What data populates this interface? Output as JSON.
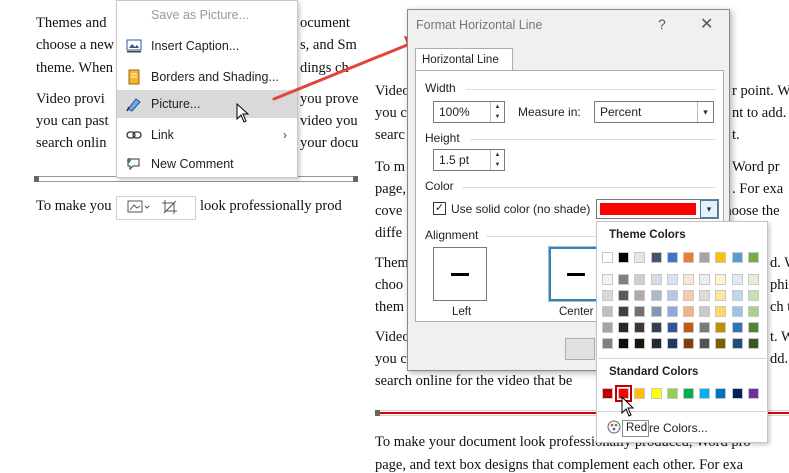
{
  "document": {
    "left_lines": [
      "Themes and",
      "choose a new",
      "theme. When",
      "Video provi",
      "you can past",
      "search onlin"
    ],
    "left_line_after_rule": "To make you",
    "left_fragments": [
      "ocument",
      "s, and Sm",
      "dings ch",
      "you prove",
      "video you",
      "your docu",
      "look professionally prod"
    ],
    "right_lines": [
      "Video",
      "you c",
      "searc",
      "To m",
      "page,",
      "cove",
      "diffe",
      "Them",
      "choo",
      "them",
      "Video",
      "you c",
      "search online for the video that be"
    ],
    "right_fragments": [
      "r point. W",
      "nt to add. Y",
      "t.",
      "Word pr",
      ". For exa",
      "choose the",
      "d. W",
      "phic",
      "ch t",
      "t. W",
      "dd. "
    ],
    "bottom_lines": [
      "To make your document look professionally produced, Word pro",
      "page, and text box designs that complement each other. For exa"
    ]
  },
  "context_menu": {
    "items": [
      {
        "label": "Save as Picture...",
        "icon": "save-picture-icon",
        "disabled": true
      },
      {
        "label": "Insert Caption...",
        "icon": "caption-icon",
        "disabled": false
      },
      {
        "label": "Borders and Shading...",
        "icon": "borders-shading-icon",
        "disabled": false
      },
      {
        "label": "Picture...",
        "icon": "picture-format-icon",
        "disabled": false,
        "hover": true
      },
      {
        "label": "Link",
        "icon": "link-icon",
        "disabled": false,
        "submenu": true
      },
      {
        "label": "New Comment",
        "icon": "new-comment-icon",
        "disabled": false
      }
    ]
  },
  "dialog": {
    "title": "Format Horizontal Line",
    "help": "?",
    "close": "✕",
    "tab_label": "Horizontal Line",
    "width_section": "Width",
    "width_value": "100%",
    "measure_label": "Measure in:",
    "measure_value": "Percent",
    "height_section": "Height",
    "height_value": "1.5 pt",
    "color_section": "Color",
    "solid_color_label": "Use solid color (no shade)",
    "solid_color_checked": true,
    "selected_color": "#ff0000",
    "alignment_section": "Alignment",
    "alignment_options": [
      "Left",
      "Center"
    ],
    "alignment_selected": "Center"
  },
  "palette": {
    "theme_header": "Theme Colors",
    "standard_header": "Standard Colors",
    "more_colors": "More Colors...",
    "more_colors_visible": "re Colors...",
    "theme_top_row": [
      "#ffffff",
      "#000000",
      "#e7e6e6",
      "#44546a",
      "#4472c4",
      "#ed7d31",
      "#a5a5a5",
      "#ffc000",
      "#5b9bd5",
      "#70ad47"
    ],
    "theme_columns": [
      [
        "#f2f2f2",
        "#d9d9d9",
        "#bfbfbf",
        "#a6a6a6",
        "#808080"
      ],
      [
        "#808080",
        "#595959",
        "#404040",
        "#262626",
        "#0d0d0d"
      ],
      [
        "#d0cece",
        "#aeabab",
        "#757171",
        "#3a3838",
        "#171616"
      ],
      [
        "#d6dce4",
        "#adb9ca",
        "#8497b0",
        "#333f4f",
        "#222a35"
      ],
      [
        "#d9e1f2",
        "#b4c6e7",
        "#8ea9db",
        "#2f5597",
        "#1f3864"
      ],
      [
        "#fbe5d6",
        "#f8cbad",
        "#f4b183",
        "#c55a11",
        "#843c0c"
      ],
      [
        "#ededed",
        "#dbdbdb",
        "#c9c9c9",
        "#7b7b7b",
        "#525252"
      ],
      [
        "#fff2cc",
        "#ffe699",
        "#ffd966",
        "#bf8f00",
        "#7f6000"
      ],
      [
        "#deebf7",
        "#bdd7ee",
        "#9dc3e6",
        "#2e75b6",
        "#1f4e79"
      ],
      [
        "#e2f0d9",
        "#c5e0b4",
        "#a9d18e",
        "#548235",
        "#385723"
      ]
    ],
    "standard_colors": [
      "#c00000",
      "#ff0000",
      "#ffc000",
      "#ffff00",
      "#92d050",
      "#00b050",
      "#00b0f0",
      "#0070c0",
      "#002060",
      "#7030a0"
    ],
    "selected_standard_index": 1,
    "tooltip": "Red"
  },
  "annotation_color": "#e0453a"
}
